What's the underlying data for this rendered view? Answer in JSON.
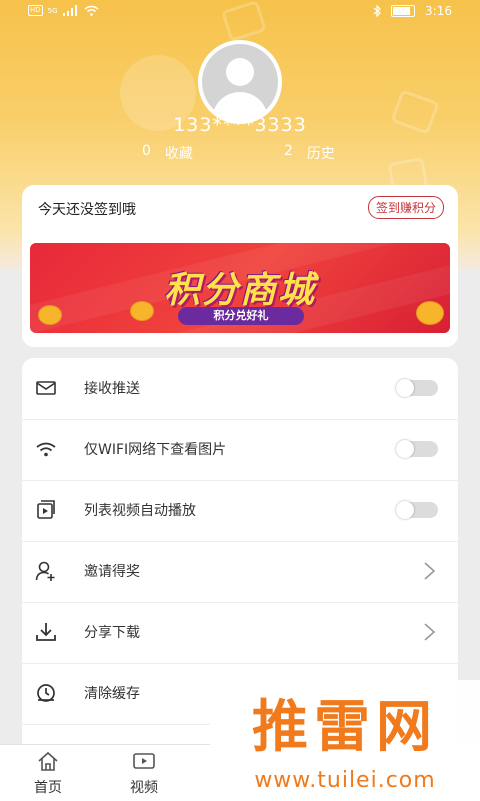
{
  "status_bar": {
    "left_badges": [
      "HD",
      "5G"
    ],
    "time": "3:16",
    "icons": [
      "signal-icon",
      "wifi-icon",
      "bluetooth-icon",
      "battery-icon"
    ]
  },
  "profile": {
    "phone": "133****3333",
    "stats": [
      {
        "count": "0",
        "label": "收藏"
      },
      {
        "count": "2",
        "label": "历史"
      }
    ]
  },
  "signin": {
    "text": "今天还没签到哦",
    "button": "签到赚积分",
    "banner_title": "积分商城",
    "banner_subtitle": "积分兑好礼"
  },
  "settings": [
    {
      "icon": "mail-icon",
      "label": "接收推送",
      "control": "toggle",
      "on": false
    },
    {
      "icon": "wifi-icon",
      "label": "仅WIFI网络下查看图片",
      "control": "toggle",
      "on": false
    },
    {
      "icon": "video-play-icon",
      "label": "列表视频自动播放",
      "control": "toggle",
      "on": false
    },
    {
      "icon": "invite-user-icon",
      "label": "邀请得奖",
      "control": "chevron"
    },
    {
      "icon": "download-icon",
      "label": "分享下载",
      "control": "chevron"
    },
    {
      "icon": "clear-cache-icon",
      "label": "清除缓存",
      "control": "none"
    }
  ],
  "tabbar": [
    {
      "icon": "home-icon",
      "label": "首页"
    },
    {
      "icon": "video-icon",
      "label": "视频"
    }
  ],
  "watermark": {
    "main": "推雷网",
    "url": "www.tuilei.com"
  },
  "colors": {
    "header": "#f6c24a",
    "accent": "#c2373c",
    "watermark": "#f07a1c"
  }
}
